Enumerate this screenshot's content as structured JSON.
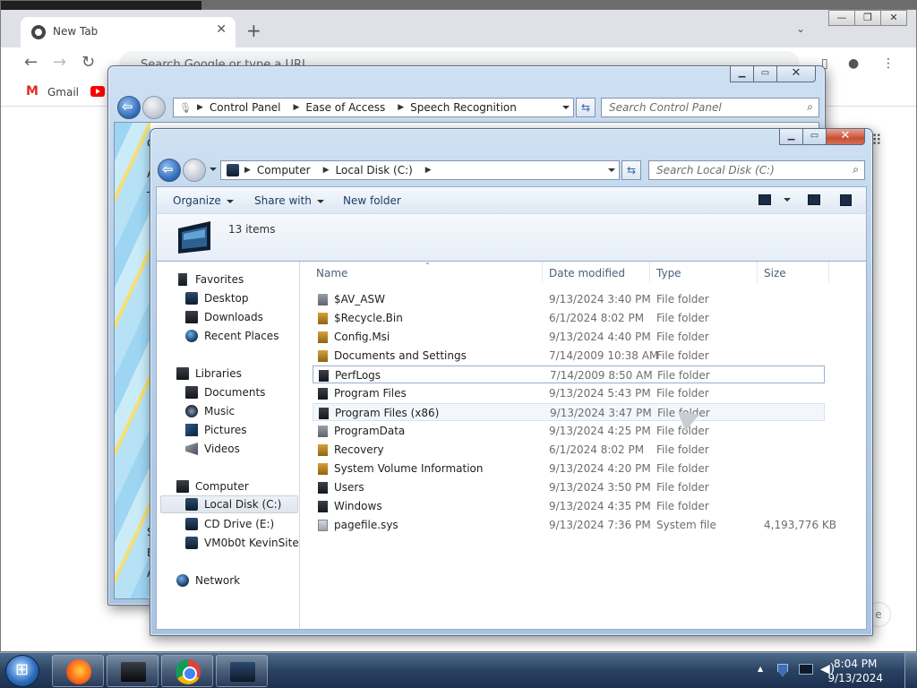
{
  "chrome": {
    "tab_title": "New Tab",
    "tab_close": "✕",
    "new_tab": "+",
    "tab_list": "⌄",
    "omnibox_placeholder": "Search Google or type a URL",
    "bookmarks": [
      {
        "label": "Gmail",
        "icon": "gmail-icon"
      },
      {
        "label": "",
        "icon": "youtube-icon"
      }
    ],
    "bubble_text": "e"
  },
  "control_panel": {
    "breadcrumbs": [
      "Control Panel",
      "Ease of Access",
      "Speech Recognition"
    ],
    "search_placeholder": "Search Control Panel",
    "peek_letters": [
      "C",
      "A",
      "T",
      "S",
      "E",
      "A"
    ]
  },
  "explorer": {
    "breadcrumbs": [
      "Computer",
      "Local Disk (C:)"
    ],
    "search_placeholder": "Search Local Disk (C:)",
    "commands": {
      "organize": "Organize",
      "share": "Share with",
      "new_folder": "New folder"
    },
    "item_count": "13 items",
    "nav": {
      "favorites": {
        "label": "Favorites",
        "items": [
          "Desktop",
          "Downloads",
          "Recent Places"
        ]
      },
      "libraries": {
        "label": "Libraries",
        "items": [
          "Documents",
          "Music",
          "Pictures",
          "Videos"
        ]
      },
      "computer": {
        "label": "Computer",
        "items": [
          "Local Disk (C:)",
          "CD Drive (E:)",
          "VM0b0t KevinSite"
        ]
      },
      "network": {
        "label": "Network"
      }
    },
    "columns": {
      "name": "Name",
      "date": "Date modified",
      "type": "Type",
      "size": "Size"
    },
    "files": [
      {
        "name": "$AV_ASW",
        "date": "9/13/2024 3:40 PM",
        "type": "File folder",
        "size": "",
        "icon": "hidden-folder-icon"
      },
      {
        "name": "$Recycle.Bin",
        "date": "6/1/2024 8:02 PM",
        "type": "File folder",
        "size": "",
        "icon": "locked-folder-icon"
      },
      {
        "name": "Config.Msi",
        "date": "9/13/2024 4:40 PM",
        "type": "File folder",
        "size": "",
        "icon": "locked-folder-icon"
      },
      {
        "name": "Documents and Settings",
        "date": "7/14/2009 10:38 AM",
        "type": "File folder",
        "size": "",
        "icon": "locked-folder-icon"
      },
      {
        "name": "PerfLogs",
        "date": "7/14/2009 8:50 AM",
        "type": "File folder",
        "size": "",
        "icon": "folder-icon"
      },
      {
        "name": "Program Files",
        "date": "9/13/2024 5:43 PM",
        "type": "File folder",
        "size": "",
        "icon": "folder-icon"
      },
      {
        "name": "Program Files (x86)",
        "date": "9/13/2024 3:47 PM",
        "type": "File folder",
        "size": "",
        "icon": "folder-icon"
      },
      {
        "name": "ProgramData",
        "date": "9/13/2024 4:25 PM",
        "type": "File folder",
        "size": "",
        "icon": "hidden-folder-icon"
      },
      {
        "name": "Recovery",
        "date": "6/1/2024 8:02 PM",
        "type": "File folder",
        "size": "",
        "icon": "locked-folder-icon"
      },
      {
        "name": "System Volume Information",
        "date": "9/13/2024 4:20 PM",
        "type": "File folder",
        "size": "",
        "icon": "locked-folder-icon"
      },
      {
        "name": "Users",
        "date": "9/13/2024 3:50 PM",
        "type": "File folder",
        "size": "",
        "icon": "folder-icon"
      },
      {
        "name": "Windows",
        "date": "9/13/2024 4:35 PM",
        "type": "File folder",
        "size": "",
        "icon": "folder-icon"
      },
      {
        "name": "pagefile.sys",
        "date": "9/13/2024 7:36 PM",
        "type": "System file",
        "size": "4,193,776 KB",
        "icon": "file-icon"
      }
    ]
  },
  "taskbar": {
    "apps": [
      "firefox-icon",
      "cmd-icon",
      "chrome-icon",
      "explorer-icon"
    ],
    "time": "8:04 PM",
    "date": "9/13/2024",
    "tray_arrow": "▲"
  }
}
